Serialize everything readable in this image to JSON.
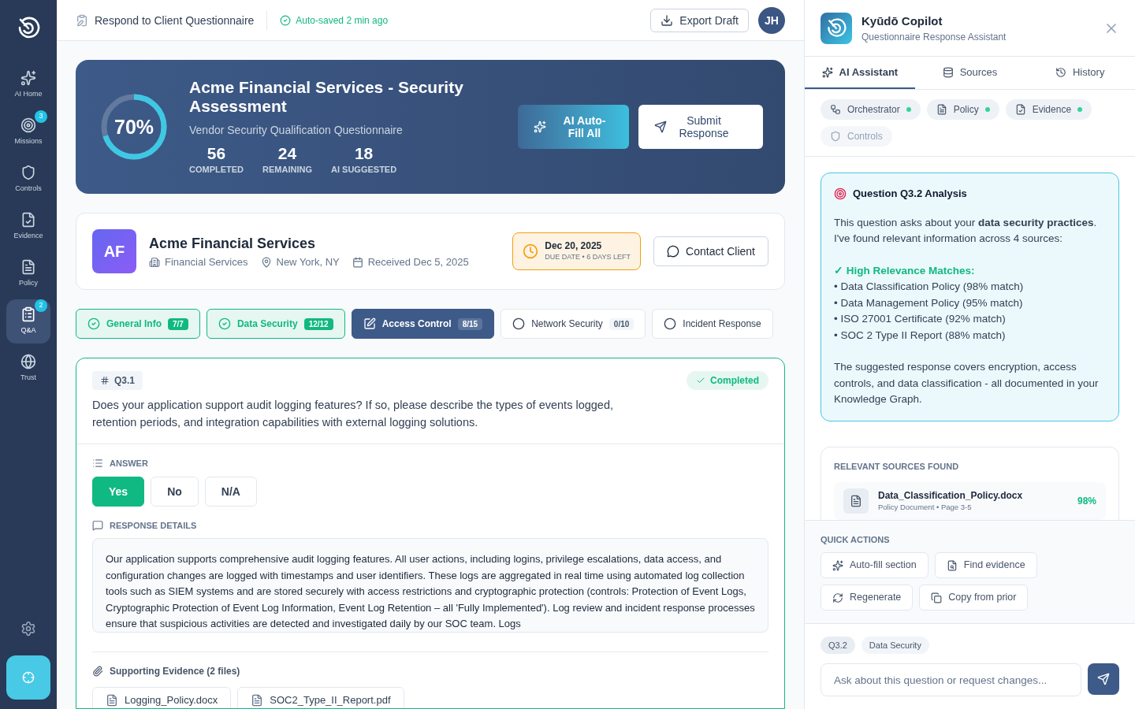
{
  "sidebar": {
    "items": [
      {
        "label": "AI Home",
        "selected": false
      },
      {
        "label": "Missions",
        "badge": "3",
        "selected": false
      },
      {
        "label": "Controls",
        "selected": false
      },
      {
        "label": "Evidence",
        "selected": false
      },
      {
        "label": "Policy",
        "selected": false
      },
      {
        "label": "Q&A",
        "badge": "2",
        "selected": true
      },
      {
        "label": "Trust",
        "selected": false
      }
    ]
  },
  "header": {
    "title": "Respond to Client Questionnaire",
    "saved": "Auto-saved 2 min ago",
    "export": "Export Draft",
    "avatar": "JH"
  },
  "hero": {
    "percent": "70%",
    "level": 0.7,
    "title": "Acme Financial Services - Security Assessment",
    "subtitle": "Vendor Security Qualification Questionnaire",
    "stats": [
      {
        "value": "56",
        "label": "COMPLETED"
      },
      {
        "value": "24",
        "label": "REMAINING"
      },
      {
        "value": "18",
        "label": "AI SUGGESTED"
      }
    ],
    "autofill": "AI Auto-Fill All",
    "submit": "Submit Response"
  },
  "client": {
    "initials": "AF",
    "name": "Acme Financial Services",
    "industry": "Financial Services",
    "location": "New York, NY",
    "received": "Received Dec 5, 2025",
    "due_date": "Dec 20, 2025",
    "due_note": "DUE DATE • 6 DAYS LEFT",
    "contact": "Contact Client"
  },
  "sections": [
    {
      "label": "General Info",
      "count": "7/7",
      "kind": "complete",
      "selected": false
    },
    {
      "label": "Data Security",
      "count": "12/12",
      "kind": "complete",
      "selected": false
    },
    {
      "label": "Access Control",
      "count": "8/15",
      "kind": "progress",
      "selected": true
    },
    {
      "label": "Network Security",
      "count": "0/10",
      "kind": "pending",
      "selected": false
    },
    {
      "label": "Incident Response",
      "kind": "pending",
      "selected": false
    }
  ],
  "question": {
    "id": "Q3.1",
    "status": "Completed",
    "text": "Does your application support audit logging features? If so, please describe the types of events logged, retention periods, and integration capabilities with external logging solutions.",
    "answer_label": "ANSWER",
    "answers": [
      {
        "label": "Yes",
        "selected": true
      },
      {
        "label": "No",
        "selected": false
      },
      {
        "label": "N/A",
        "selected": false
      }
    ],
    "details_label": "RESPONSE DETAILS",
    "details": "Our application supports comprehensive audit logging features. All user actions, including logins, privilege escalations, data access, and configuration changes are logged with timestamps and user identifiers. These logs are aggregated in real time using automated log collection tools such as SIEM systems and are stored securely with access restrictions and cryptographic protection (controls: Protection of Event Logs, Cryptographic Protection of Event Log Information, Event Log Retention – all 'Fully Implemented'). Log review and incident response processes ensure that suspicious activities are detected and investigated daily by our SOC team. Logs",
    "evidence_label": "Supporting Evidence (2 files)",
    "files": [
      "Logging_Policy.docx",
      "SOC2_Type_II_Report.pdf"
    ]
  },
  "copilot": {
    "name": "Kyūdō Copilot",
    "subtitle": "Questionnaire Response Assistant",
    "tabs": [
      {
        "label": "AI Assistant",
        "selected": true
      },
      {
        "label": "Sources",
        "selected": false
      },
      {
        "label": "History",
        "selected": false
      }
    ],
    "agents": [
      {
        "label": "Orchestrator",
        "active": true
      },
      {
        "label": "Policy",
        "active": true
      },
      {
        "label": "Evidence",
        "active": true
      },
      {
        "label": "Controls",
        "active": false
      }
    ],
    "analysis": {
      "title": "Question Q3.2 Analysis",
      "intro": "This question asks about your **data security practices**. I've found relevant information across 4 sources:",
      "matches_title": "✓ High Relevance Matches:",
      "matches": [
        "• Data Classification Policy (98% match)",
        "• Data Management Policy (95% match)",
        "• ISO 27001 Certificate (92% match)",
        "• SOC 2 Type II Report (88% match)"
      ],
      "summary": "The suggested response covers encryption, access controls, and data classification - all documented in your Knowledge Graph."
    },
    "sources_title": "RELEVANT SOURCES FOUND",
    "sources": [
      {
        "name": "Data_Classification_Policy.docx",
        "meta": "Policy Document • Page 3-5",
        "score": "98%"
      }
    ],
    "actions_title": "QUICK ACTIONS",
    "actions": [
      "Auto-fill section",
      "Find evidence",
      "Regenerate",
      "Copy from prior"
    ],
    "context": [
      "Q3.2",
      "Data Security"
    ],
    "placeholder": "Ask about this question or request changes..."
  }
}
